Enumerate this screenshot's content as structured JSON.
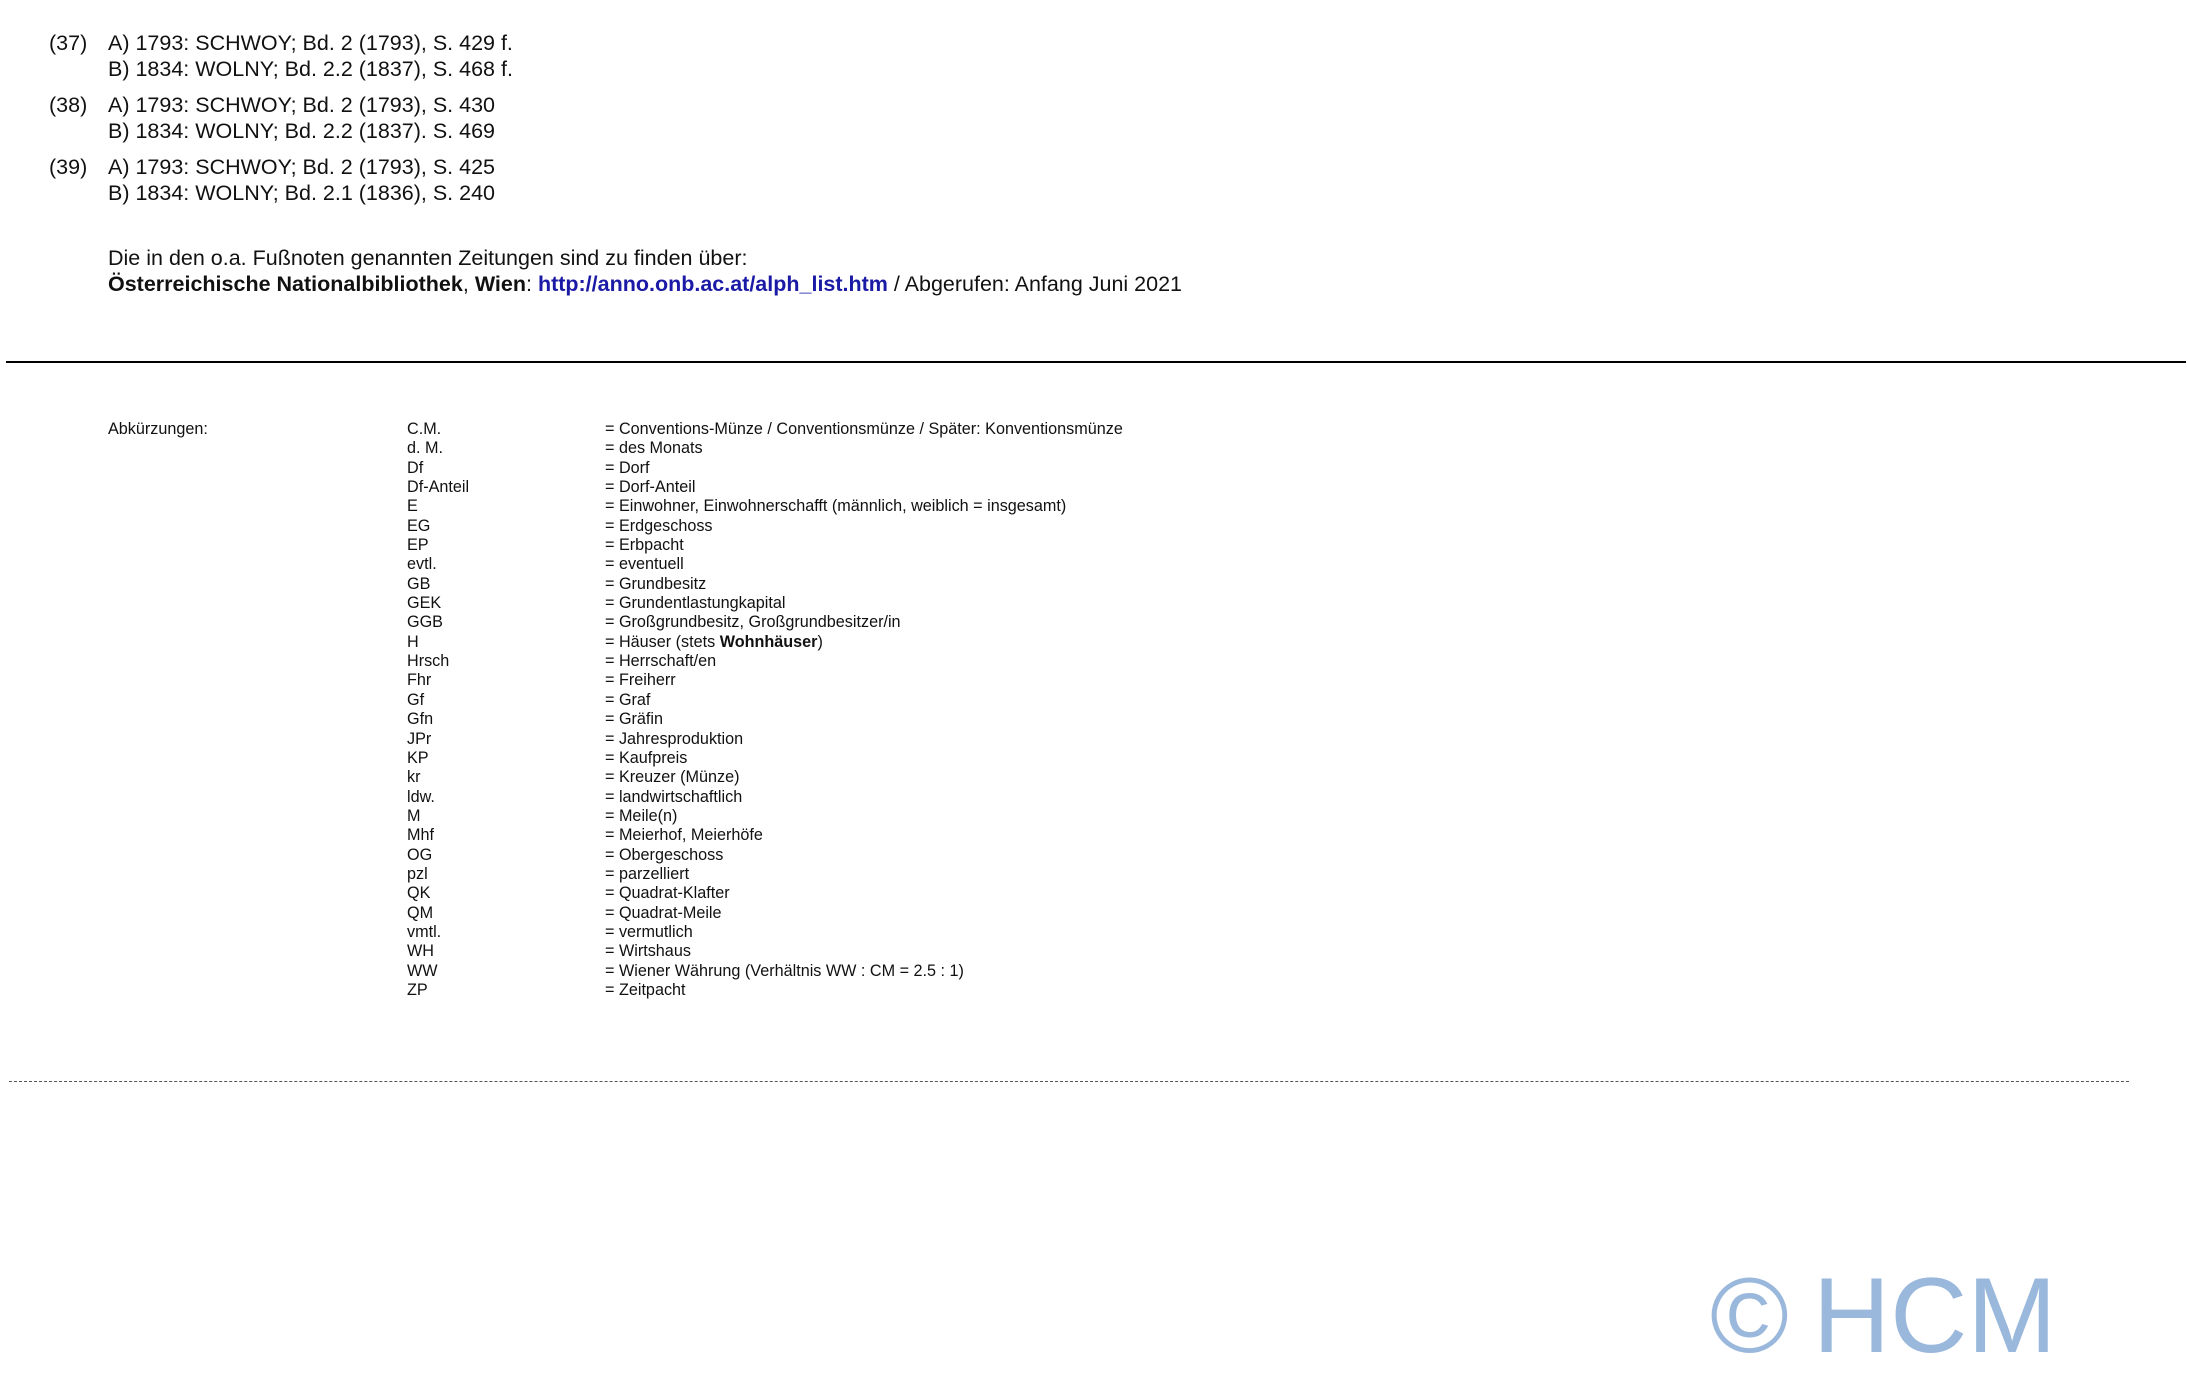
{
  "footnotes": [
    {
      "number": "(37)",
      "a": "A) 1793: SCHWOY; Bd. 2 (1793), S. 429 f.",
      "b": "B) 1834: WOLNY; Bd. 2.2 (1837), S. 468 f."
    },
    {
      "number": "(38)",
      "a": "A) 1793: SCHWOY; Bd. 2 (1793), S. 430",
      "b": "B) 1834: WOLNY; Bd. 2.2 (1837). S. 469"
    },
    {
      "number": "(39)",
      "a": "A) 1793: SCHWOY; Bd. 2 (1793), S. 425",
      "b": "B) 1834: WOLNY; Bd. 2.1 (1836), S. 240"
    }
  ],
  "source_note": {
    "line1": "Die in den o.a. Fußnoten genannten Zeitungen sind zu finden über:",
    "institution": "Österreichische Nationalbibliothek",
    "separator1": ", ",
    "city": "Wien",
    "separator2": ": ",
    "url": "http://anno.onb.ac.at/alph_list.htm",
    "suffix": " / Abgerufen: Anfang Juni 2021"
  },
  "abbreviations": {
    "heading": "Abkürzungen:",
    "items": [
      {
        "key": "C.M.",
        "value": "= Conventions-Münze / Conventionsmünze / Später: Konventionsmünze"
      },
      {
        "key": "d. M.",
        "value": "= des Monats"
      },
      {
        "key": "Df",
        "value": "= Dorf"
      },
      {
        "key": "Df-Anteil",
        "value": "= Dorf-Anteil"
      },
      {
        "key": "E",
        "value": "= Einwohner, Einwohnerschafft (männlich, weiblich = insgesamt)"
      },
      {
        "key": "EG",
        "value": "= Erdgeschoss"
      },
      {
        "key": "EP",
        "value": "= Erbpacht"
      },
      {
        "key": "evtl.",
        "value": "= eventuell"
      },
      {
        "key": "GB",
        "value": "= Grundbesitz"
      },
      {
        "key": "GEK",
        "value": "= Grundentlastungkapital"
      },
      {
        "key": "GGB",
        "value": "= Großgrundbesitz, Großgrundbesitzer/in"
      },
      {
        "key": "H",
        "value_pre": "= Häuser (stets ",
        "value_bold": "Wohnhäuser",
        "value_post": ")"
      },
      {
        "key": "Hrsch",
        "value": "= Herrschaft/en"
      },
      {
        "key": "Fhr",
        "value": "= Freiherr"
      },
      {
        "key": "Gf",
        "value": "= Graf"
      },
      {
        "key": "Gfn",
        "value": "= Gräfin"
      },
      {
        "key": "JPr",
        "value": "= Jahresproduktion"
      },
      {
        "key": "KP",
        "value": "= Kaufpreis"
      },
      {
        "key": "kr",
        "value": "= Kreuzer (Münze)"
      },
      {
        "key": "ldw.",
        "value": "= landwirtschaftlich"
      },
      {
        "key": "M",
        "value": "= Meile(n)"
      },
      {
        "key": "Mhf",
        "value": "= Meierhof, Meierhöfe"
      },
      {
        "key": "OG",
        "value": "= Obergeschoss"
      },
      {
        "key": "pzl",
        "value": "= parzelliert"
      },
      {
        "key": "QK",
        "value": "= Quadrat-Klafter"
      },
      {
        "key": "QM",
        "value": "= Quadrat-Meile"
      },
      {
        "key": "vmtl.",
        "value": "= vermutlich"
      },
      {
        "key": "WH",
        "value": "= Wirtshaus"
      },
      {
        "key": "WW",
        "value": "= Wiener Währung (Verhältnis WW : CM = 2.5 : 1)"
      },
      {
        "key": "ZP",
        "value": "= Zeitpacht"
      }
    ]
  },
  "watermark": {
    "symbol": "©",
    "text": "HCM",
    "color": "#9ab8dc"
  },
  "colors": {
    "link": "#1a1aa6",
    "text": "#111111"
  }
}
